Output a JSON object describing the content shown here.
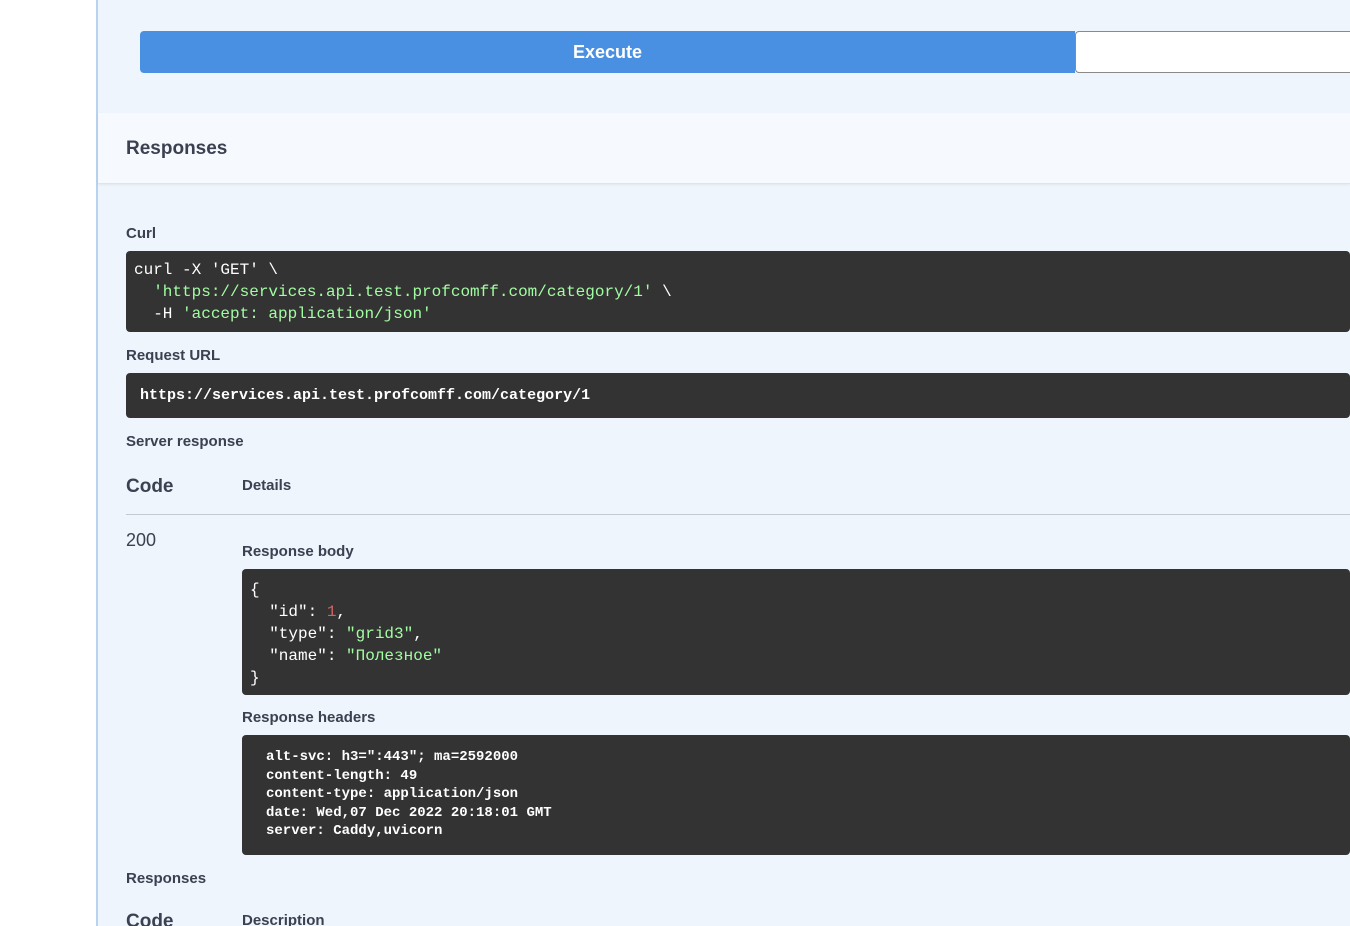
{
  "execute": {
    "label": "Execute",
    "clear_label": ""
  },
  "responses_section": {
    "title": "Responses"
  },
  "curl": {
    "label": "Curl",
    "line1": "curl -X 'GET' \\",
    "line2_url": "'https://services.api.test.profcomff.com/category/1'",
    "line2_tail": " \\",
    "line3_flag": "-H ",
    "line3_value": "'accept: application/json'"
  },
  "request_url": {
    "label": "Request URL",
    "value": "https://services.api.test.profcomff.com/category/1"
  },
  "server_response": {
    "label": "Server response",
    "col_code": "Code",
    "col_details": "Details",
    "code": "200",
    "body_label": "Response body",
    "body": {
      "open": "{",
      "id_key": "\"id\": ",
      "id_val": "1",
      "type_key": "\"type\": ",
      "type_val": "\"grid3\"",
      "name_key": "\"name\": ",
      "name_val": "\"Полезное\"",
      "close": "}"
    },
    "headers_label": "Response headers",
    "headers": [
      "alt-svc: h3=\":443\"; ma=2592000",
      "content-length: 49",
      "content-type: application/json",
      "date: Wed,07 Dec 2022 20:18:01 GMT",
      "server: Caddy,uvicorn"
    ]
  },
  "responses_list": {
    "label": "Responses",
    "col_code": "Code",
    "col_description": "Description"
  }
}
